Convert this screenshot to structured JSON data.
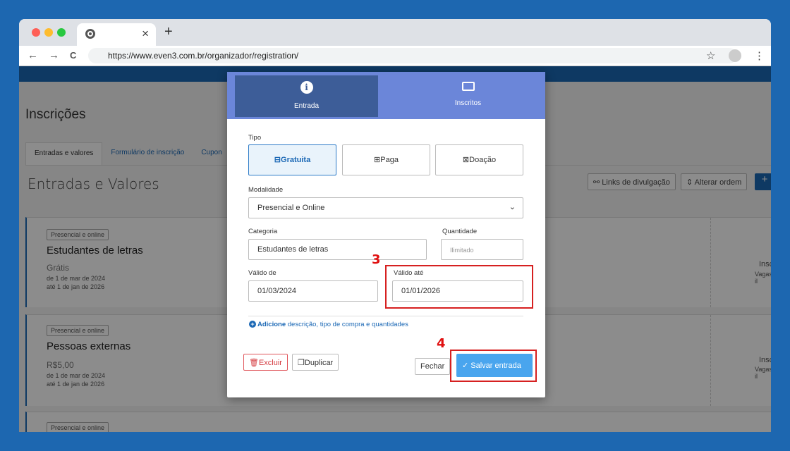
{
  "browser": {
    "tab_close": "×",
    "new_tab": "+",
    "back": "←",
    "forward": "→",
    "reload": "C",
    "url": "https://www.even3.com.br/organizador/registration/",
    "star": "☆",
    "menu": "⋮"
  },
  "page": {
    "heading": "Inscrições",
    "tabs": [
      "Entradas e valores",
      "Formulário de inscrição",
      "Cupon"
    ],
    "section_title": "Entradas e Valores",
    "links_button": "Links de divulgação",
    "order_button": "Alterar ordem",
    "plus": "+",
    "cards": [
      {
        "badge": "Presencial e online",
        "title": "Estudantes de letras",
        "price": "Grátis",
        "date_from": "de 1 de mar de 2024",
        "date_to": "até 1 de jan de 2026",
        "insc": "Insc",
        "vagas": "Vagas il"
      },
      {
        "badge": "Presencial e online",
        "title": "Pessoas externas",
        "price": "R$5,00",
        "date_from": "de 1 de mar de 2024",
        "date_to": "até 1 de jan de 2026",
        "insc": "Insc",
        "vagas": "Vagas il"
      },
      {
        "badge": "Presencial e online"
      }
    ]
  },
  "modal": {
    "tab_entrada": "Entrada",
    "tab_inscritos": "Inscritos",
    "tipo_label": "Tipo",
    "tipo_options": [
      "Gratuita",
      "Paga",
      "Doação"
    ],
    "modalidade_label": "Modalidade",
    "modalidade_value": "Presencial e Online",
    "categoria_label": "Categoria",
    "categoria_value": "Estudantes de letras",
    "quantidade_label": "Quantidade",
    "quantidade_placeholder": "Ilimitado",
    "valido_de_label": "Válido de",
    "valido_de_value": "01/03/2024",
    "valido_ate_label": "Válido até",
    "valido_ate_value": "01/01/2026",
    "add_bold": "Adicione",
    "add_rest": " descrição, tipo de compra e quantidades",
    "btn_excluir": "Excluir",
    "btn_duplicar": "Duplicar",
    "btn_fechar": "Fechar",
    "btn_salvar": "Salvar entrada"
  },
  "annotations": {
    "step3": "3",
    "step4": "4"
  },
  "colors": {
    "accent": "#1b68b5",
    "highlight": "#d62020",
    "save": "#49a5ee",
    "modal_header": "#6b86d9"
  }
}
